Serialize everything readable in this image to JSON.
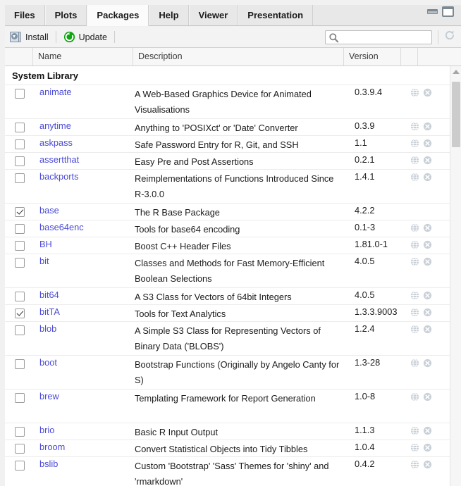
{
  "window": {
    "minimize_label": "Minimize",
    "maximize_label": "Maximize"
  },
  "tabs": [
    {
      "label": "Files",
      "active": false
    },
    {
      "label": "Plots",
      "active": false
    },
    {
      "label": "Packages",
      "active": true
    },
    {
      "label": "Help",
      "active": false
    },
    {
      "label": "Viewer",
      "active": false
    },
    {
      "label": "Presentation",
      "active": false
    }
  ],
  "toolbar": {
    "install_label": "Install",
    "update_label": "Update",
    "install_icon": "install-package-icon",
    "update_icon": "update-circular-arrow-icon",
    "refresh_icon": "refresh-icon"
  },
  "search": {
    "value": "",
    "placeholder": "",
    "icon": "search-icon"
  },
  "table": {
    "columns": [
      "",
      "Name",
      "Description",
      "Version",
      "",
      ""
    ],
    "group_header": "System Library",
    "rows": [
      {
        "checked": false,
        "name": "animate",
        "description": "A Web-Based Graphics Device for Animated Visualisations",
        "version": "0.3.9.4",
        "actions": true
      },
      {
        "checked": false,
        "name": "anytime",
        "description": "Anything to 'POSIXct' or 'Date' Converter",
        "version": "0.3.9",
        "actions": true
      },
      {
        "checked": false,
        "name": "askpass",
        "description": "Safe Password Entry for R, Git, and SSH",
        "version": "1.1",
        "actions": true
      },
      {
        "checked": false,
        "name": "assertthat",
        "description": "Easy Pre and Post Assertions",
        "version": "0.2.1",
        "actions": true
      },
      {
        "checked": false,
        "name": "backports",
        "description": "Reimplementations of Functions Introduced Since R-3.0.0",
        "version": "1.4.1",
        "actions": true
      },
      {
        "checked": true,
        "name": "base",
        "description": "The R Base Package",
        "version": "4.2.2",
        "actions": false
      },
      {
        "checked": false,
        "name": "base64enc",
        "description": "Tools for base64 encoding",
        "version": "0.1-3",
        "actions": true
      },
      {
        "checked": false,
        "name": "BH",
        "description": "Boost C++ Header Files",
        "version": "1.81.0-1",
        "actions": true
      },
      {
        "checked": false,
        "name": "bit",
        "description": "Classes and Methods for Fast Memory-Efficient Boolean Selections",
        "version": "4.0.5",
        "actions": true
      },
      {
        "checked": false,
        "name": "bit64",
        "description": "A S3 Class for Vectors of 64bit Integers",
        "version": "4.0.5",
        "actions": true
      },
      {
        "checked": true,
        "name": "bitTA",
        "description": "Tools for Text Analytics",
        "version": "1.3.3.9003",
        "actions": true
      },
      {
        "checked": false,
        "name": "blob",
        "description": "A Simple S3 Class for Representing Vectors of Binary Data ('BLOBS')",
        "version": "1.2.4",
        "actions": true
      },
      {
        "checked": false,
        "name": "boot",
        "description": "Bootstrap Functions (Originally by Angelo Canty for S)",
        "version": "1.3-28",
        "actions": true
      },
      {
        "checked": false,
        "name": "brew",
        "description": "Templating Framework for Report Generation",
        "version": "1.0-8",
        "actions": true
      },
      {
        "checked": false,
        "name": "brio",
        "description": "Basic R Input Output",
        "version": "1.1.3",
        "actions": true
      },
      {
        "checked": false,
        "name": "broom",
        "description": "Convert Statistical Objects into Tidy Tibbles",
        "version": "1.0.4",
        "actions": true
      },
      {
        "checked": false,
        "name": "bslib",
        "description": "Custom 'Bootstrap' 'Sass' Themes for 'shiny' and 'rmarkdown'",
        "version": "0.4.2",
        "actions": true
      }
    ],
    "row_action_icons": {
      "browse": "globe-icon",
      "remove": "remove-circle-icon"
    }
  },
  "scrollbar": {
    "up_arrow_icon": "scroll-up-arrow-icon",
    "thumb": "scroll-thumb"
  },
  "colors": {
    "link": "#4b4bd6",
    "update_green": "#12a312",
    "tab_active_bg": "#fbfbfb",
    "chrome_bg": "#e8e8e8"
  }
}
